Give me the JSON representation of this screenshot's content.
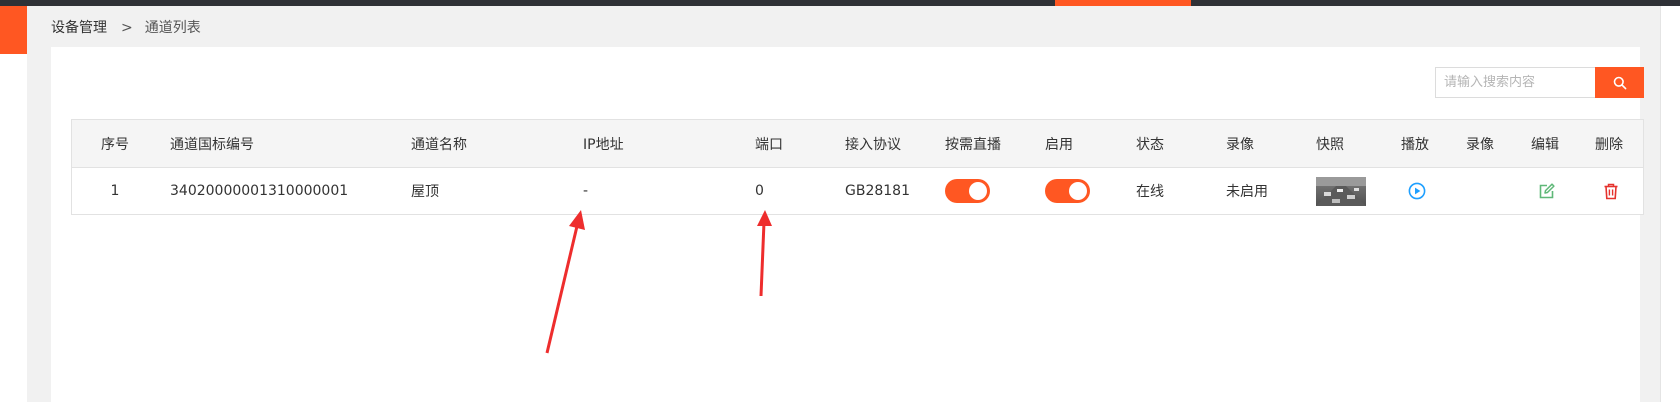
{
  "colors": {
    "accent": "#ff5722",
    "online": "#2eaf4a",
    "play": "#1e9fff",
    "edit": "#5fb878",
    "delete": "#e5322d"
  },
  "breadcrumb": {
    "root": "设备管理",
    "separator": ">",
    "current": "通道列表"
  },
  "search": {
    "placeholder": "请输入搜索内容",
    "value": "",
    "icon": "search-icon"
  },
  "table": {
    "headers": {
      "index": "序号",
      "channel_code": "通道国标编号",
      "channel_name": "通道名称",
      "ip": "IP地址",
      "port": "端口",
      "protocol": "接入协议",
      "on_demand": "按需直播",
      "enabled": "启用",
      "status": "状态",
      "recording": "录像",
      "snapshot": "快照",
      "play": "播放",
      "record": "录像",
      "edit": "编辑",
      "delete": "删除"
    },
    "rows": [
      {
        "index": "1",
        "channel_code": "34020000001310000001",
        "channel_name": "屋顶",
        "ip": "-",
        "port": "0",
        "protocol": "GB28181",
        "on_demand": true,
        "enabled": true,
        "status": "在线",
        "recording": "未启用",
        "play_icon": "play-circle-icon",
        "edit_icon": "edit-icon",
        "delete_icon": "trash-icon"
      }
    ]
  }
}
